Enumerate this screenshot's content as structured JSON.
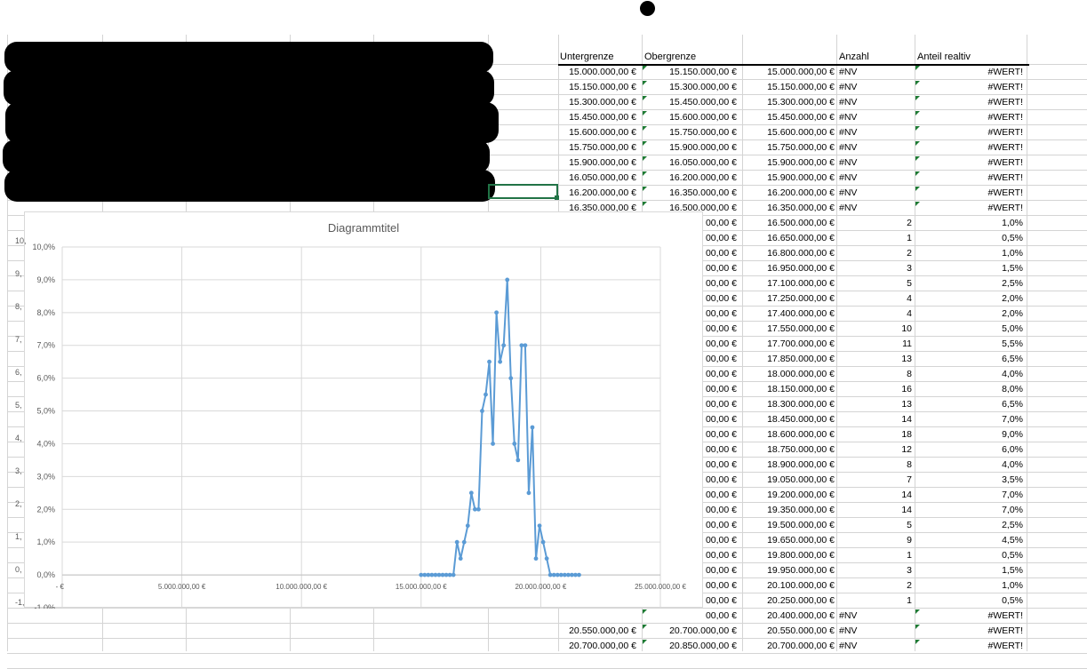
{
  "headers": {
    "lower": "Untergrenze",
    "upper": "Obergrenze",
    "count": "Anzahl",
    "share": "Anteil realtiv"
  },
  "error_na": "#NV",
  "error_value": "#WERT!",
  "rows": [
    {
      "lower": "15.000.000,00 €",
      "upper": "15.150.000,00 €",
      "bin": "15.000.000,00 €",
      "count": "#NV",
      "share": "#WERT!"
    },
    {
      "lower": "15.150.000,00 €",
      "upper": "15.300.000,00 €",
      "bin": "15.150.000,00 €",
      "count": "#NV",
      "share": "#WERT!"
    },
    {
      "lower": "15.300.000,00 €",
      "upper": "15.450.000,00 €",
      "bin": "15.300.000,00 €",
      "count": "#NV",
      "share": "#WERT!"
    },
    {
      "lower": "15.450.000,00 €",
      "upper": "15.600.000,00 €",
      "bin": "15.450.000,00 €",
      "count": "#NV",
      "share": "#WERT!"
    },
    {
      "lower": "15.600.000,00 €",
      "upper": "15.750.000,00 €",
      "bin": "15.600.000,00 €",
      "count": "#NV",
      "share": "#WERT!"
    },
    {
      "lower": "15.750.000,00 €",
      "upper": "15.900.000,00 €",
      "bin": "15.750.000,00 €",
      "count": "#NV",
      "share": "#WERT!"
    },
    {
      "lower": "15.900.000,00 €",
      "upper": "16.050.000,00 €",
      "bin": "15.900.000,00 €",
      "count": "#NV",
      "share": "#WERT!"
    },
    {
      "lower": "16.050.000,00 €",
      "upper": "16.200.000,00 €",
      "bin": "15.900.000,00 €",
      "count": "#NV",
      "share": "#WERT!"
    },
    {
      "lower": "16.200.000,00 €",
      "upper": "16.350.000,00 €",
      "bin": "16.200.000,00 €",
      "count": "#NV",
      "share": "#WERT!"
    },
    {
      "lower": "16.350.000,00 €",
      "upper": "16.500.000,00 €",
      "bin": "16.350.000,00 €",
      "count": "#NV",
      "share": "#WERT!"
    },
    {
      "upper": "00,00 €",
      "bin": "16.500.000,00 €",
      "count": "2",
      "share": "1,0%"
    },
    {
      "upper": "00,00 €",
      "bin": "16.650.000,00 €",
      "count": "1",
      "share": "0,5%"
    },
    {
      "upper": "00,00 €",
      "bin": "16.800.000,00 €",
      "count": "2",
      "share": "1,0%"
    },
    {
      "upper": "00,00 €",
      "bin": "16.950.000,00 €",
      "count": "3",
      "share": "1,5%"
    },
    {
      "upper": "00,00 €",
      "bin": "17.100.000,00 €",
      "count": "5",
      "share": "2,5%"
    },
    {
      "upper": "00,00 €",
      "bin": "17.250.000,00 €",
      "count": "4",
      "share": "2,0%"
    },
    {
      "upper": "00,00 €",
      "bin": "17.400.000,00 €",
      "count": "4",
      "share": "2,0%"
    },
    {
      "upper": "00,00 €",
      "bin": "17.550.000,00 €",
      "count": "10",
      "share": "5,0%"
    },
    {
      "upper": "00,00 €",
      "bin": "17.700.000,00 €",
      "count": "11",
      "share": "5,5%"
    },
    {
      "upper": "00,00 €",
      "bin": "17.850.000,00 €",
      "count": "13",
      "share": "6,5%"
    },
    {
      "upper": "00,00 €",
      "bin": "18.000.000,00 €",
      "count": "8",
      "share": "4,0%"
    },
    {
      "upper": "00,00 €",
      "bin": "18.150.000,00 €",
      "count": "16",
      "share": "8,0%"
    },
    {
      "upper": "00,00 €",
      "bin": "18.300.000,00 €",
      "count": "13",
      "share": "6,5%"
    },
    {
      "upper": "00,00 €",
      "bin": "18.450.000,00 €",
      "count": "14",
      "share": "7,0%"
    },
    {
      "upper": "00,00 €",
      "bin": "18.600.000,00 €",
      "count": "18",
      "share": "9,0%"
    },
    {
      "upper": "00,00 €",
      "bin": "18.750.000,00 €",
      "count": "12",
      "share": "6,0%"
    },
    {
      "upper": "00,00 €",
      "bin": "18.900.000,00 €",
      "count": "8",
      "share": "4,0%"
    },
    {
      "upper": "00,00 €",
      "bin": "19.050.000,00 €",
      "count": "7",
      "share": "3,5%"
    },
    {
      "upper": "00,00 €",
      "bin": "19.200.000,00 €",
      "count": "14",
      "share": "7,0%"
    },
    {
      "upper": "00,00 €",
      "bin": "19.350.000,00 €",
      "count": "14",
      "share": "7,0%"
    },
    {
      "upper": "00,00 €",
      "bin": "19.500.000,00 €",
      "count": "5",
      "share": "2,5%"
    },
    {
      "upper": "00,00 €",
      "bin": "19.650.000,00 €",
      "count": "9",
      "share": "4,5%"
    },
    {
      "upper": "00,00 €",
      "bin": "19.800.000,00 €",
      "count": "1",
      "share": "0,5%"
    },
    {
      "upper": "00,00 €",
      "bin": "19.950.000,00 €",
      "count": "3",
      "share": "1,5%"
    },
    {
      "upper": "00,00 €",
      "bin": "20.100.000,00 €",
      "count": "2",
      "share": "1,0%"
    },
    {
      "upper": "00,00 €",
      "bin": "20.250.000,00 €",
      "count": "1",
      "share": "0,5%"
    },
    {
      "upper": "00,00 €",
      "bin": "20.400.000,00 €",
      "count": "#NV",
      "share": "#WERT!"
    },
    {
      "lower": "20.550.000,00 €",
      "upper": "20.700.000,00 €",
      "bin": "20.550.000,00 €",
      "count": "#NV",
      "share": "#WERT!"
    },
    {
      "lower": "20.700.000,00 €",
      "upper": "20.850.000,00 €",
      "bin": "20.700.000,00 €",
      "count": "#NV",
      "share": "#WERT!"
    }
  ],
  "left_stub_labels": [
    "10,",
    "9,",
    "8,",
    "7,",
    "6,",
    "5,",
    "4,",
    "3,",
    "2,",
    "1,",
    "0,",
    "-1,"
  ],
  "chart_data": {
    "type": "line",
    "title": "Diagrammtitel",
    "xlabel": "",
    "ylabel": "",
    "xlim": [
      0,
      25000000
    ],
    "ylim": [
      -1.0,
      10.0
    ],
    "x_ticks": [
      0,
      5000000,
      10000000,
      15000000,
      20000000,
      25000000
    ],
    "x_tick_labels": [
      "- €",
      "5.000.000,00 €",
      "10.000.000,00 €",
      "15.000.000,00 €",
      "20.000.000,00 €",
      "25.000.000,00 €"
    ],
    "y_ticks": [
      -1,
      0,
      1,
      2,
      3,
      4,
      5,
      6,
      7,
      8,
      9,
      10
    ],
    "y_tick_labels": [
      "-1,0%",
      "0,0%",
      "1,0%",
      "2,0%",
      "3,0%",
      "4,0%",
      "5,0%",
      "6,0%",
      "7,0%",
      "8,0%",
      "9,0%",
      "10,0%"
    ],
    "grid": true,
    "legend": "none",
    "series_color": "#5b9bd5",
    "series": [
      {
        "x": [
          15000000,
          15150000,
          15300000,
          15450000,
          15600000,
          15750000,
          15900000,
          16050000,
          16200000,
          16350000,
          16500000,
          16650000,
          16800000,
          16950000,
          17100000,
          17250000,
          17400000,
          17550000,
          17700000,
          17850000,
          18000000,
          18150000,
          18300000,
          18450000,
          18600000,
          18750000,
          18900000,
          19050000,
          19200000,
          19350000,
          19500000,
          19650000,
          19800000,
          19950000,
          20100000,
          20250000,
          20400000,
          20550000,
          20700000,
          20850000,
          21000000,
          21150000,
          21300000,
          21450000,
          21600000
        ],
        "y": [
          0,
          0,
          0,
          0,
          0,
          0,
          0,
          0,
          0,
          0,
          1.0,
          0.5,
          1.0,
          1.5,
          2.5,
          2.0,
          2.0,
          5.0,
          5.5,
          6.5,
          4.0,
          8.0,
          6.5,
          7.0,
          9.0,
          6.0,
          4.0,
          3.5,
          7.0,
          7.0,
          2.5,
          4.5,
          0.5,
          1.5,
          1.0,
          0.5,
          0,
          0,
          0,
          0,
          0,
          0,
          0,
          0,
          0
        ]
      }
    ]
  }
}
